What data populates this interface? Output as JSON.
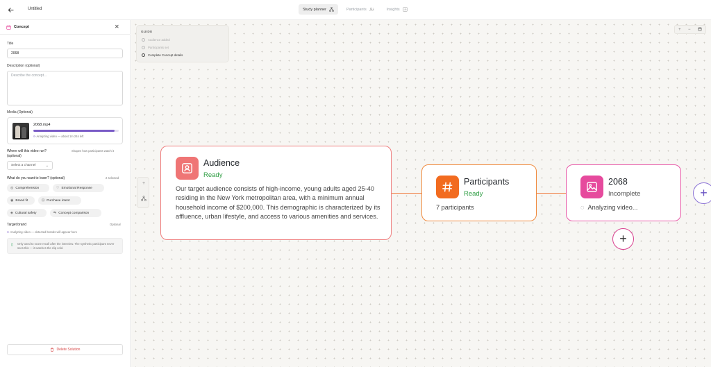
{
  "topbar": {
    "back_icon": "arrow-left-icon",
    "title": "Untitled",
    "tabs": [
      {
        "label": "Study planner",
        "icon": "flow-icon",
        "active": true
      },
      {
        "label": "Participants",
        "icon": "people-icon",
        "active": false
      },
      {
        "label": "Insights",
        "icon": "chart-icon",
        "active": false
      }
    ]
  },
  "sidebar": {
    "header": {
      "title": "Concept",
      "icon": "calendar-icon",
      "accent": "#e64a9d"
    },
    "title_field": {
      "label": "Title",
      "value": "2068"
    },
    "description_field": {
      "label": "Description (optional)",
      "placeholder": "Describe the concept..."
    },
    "media": {
      "label": "Media (Optional)",
      "file_name": "2068.mp4",
      "progress_fraction": 0.95,
      "status": "Analyzing video — about 1m 24s left"
    },
    "channel": {
      "label": "Where will this video run? (optional)",
      "hint": "Shapes how participants watch it",
      "select_placeholder": "Select a channel"
    },
    "learn": {
      "label": "What do you want to learn? (optional)",
      "count_text": "2 selected",
      "chips": [
        {
          "label": "Comprehension",
          "icon": "brain-icon"
        },
        {
          "label": "Emotional Response",
          "icon": "heart-icon"
        },
        {
          "label": "Brand fit",
          "icon": "target-icon"
        },
        {
          "label": "Purchase intent",
          "icon": "cart-icon"
        },
        {
          "label": "Cultural safety",
          "icon": "shield-icon"
        },
        {
          "label": "Concept comparison",
          "icon": "compare-icon"
        }
      ]
    },
    "target_brand": {
      "label": "Target brand",
      "optional": "Optional",
      "status": "Analyzing video — detected brands will appear here",
      "note": "Only used to score recall after the interview. The synthetic participant never sees this — it watches the clip cold."
    },
    "delete_label": "Delete Solution"
  },
  "canvas": {
    "guide": {
      "heading": "GUIDE",
      "items": [
        {
          "label": "Audience added",
          "done": true
        },
        {
          "label": "Participants set",
          "done": true
        },
        {
          "label": "Complete Concept details",
          "done": false
        }
      ]
    },
    "zoom_controls": [
      "+",
      "−",
      "fit-icon"
    ],
    "tools": [
      "plus-icon",
      "hierarchy-icon"
    ],
    "nodes": {
      "audience": {
        "title": "Audience",
        "status": "Ready",
        "body": "Our target audience consists of high-income, young adults aged 25-40 residing in the New York metropolitan area, with a minimum annual household income of $200,000. This demographic is characterized by its affluence, urban lifestyle, and access to various amenities and services.",
        "icon": "user-card-icon",
        "color": "#ef7575"
      },
      "participants": {
        "title": "Participants",
        "status": "Ready",
        "body": "7 participants",
        "icon": "hash-icon",
        "color": "#f26b1f"
      },
      "concept": {
        "title": "2068",
        "status": "Incomplete",
        "body": "Analyzing video...",
        "icon": "image-icon",
        "color": "#e64a9d"
      }
    },
    "add_buttons": [
      "+",
      "+"
    ]
  }
}
